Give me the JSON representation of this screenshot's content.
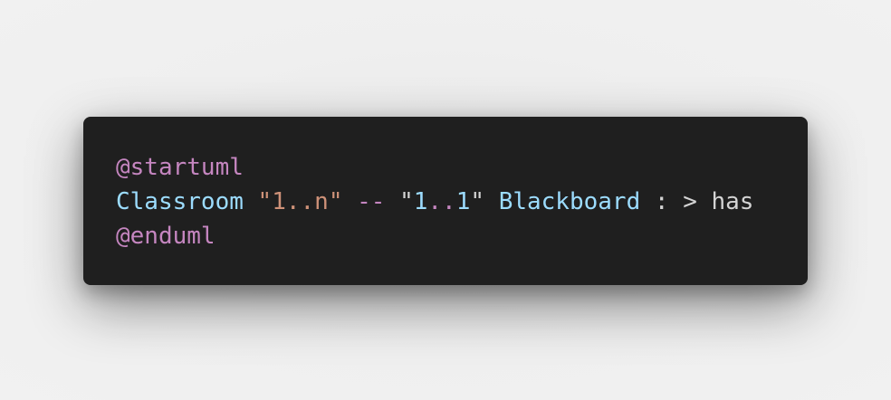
{
  "code_block": {
    "language": "plantuml",
    "lines": [
      {
        "tokens": [
          {
            "text": "@startuml",
            "kind": "directive"
          }
        ]
      },
      {
        "tokens": [
          {
            "text": "Classroom",
            "kind": "ident"
          },
          {
            "text": " ",
            "kind": "plain"
          },
          {
            "text": "\"1..n\"",
            "kind": "string"
          },
          {
            "text": " ",
            "kind": "plain"
          },
          {
            "text": "--",
            "kind": "op"
          },
          {
            "text": " ",
            "kind": "plain"
          },
          {
            "text": "\"",
            "kind": "plain"
          },
          {
            "text": "1",
            "kind": "number"
          },
          {
            "text": "..",
            "kind": "op"
          },
          {
            "text": "1",
            "kind": "number"
          },
          {
            "text": "\"",
            "kind": "plain"
          },
          {
            "text": " ",
            "kind": "plain"
          },
          {
            "text": "Blackboard",
            "kind": "ident"
          },
          {
            "text": " : > has",
            "kind": "plain"
          }
        ]
      },
      {
        "tokens": [
          {
            "text": "@enduml",
            "kind": "directive"
          }
        ]
      }
    ]
  },
  "colors": {
    "background": "#efefef",
    "card": "#1f1f1f",
    "directive": "#c586c0",
    "ident": "#9cdcfe",
    "string": "#ce9178",
    "plain": "#d4d4d4"
  }
}
